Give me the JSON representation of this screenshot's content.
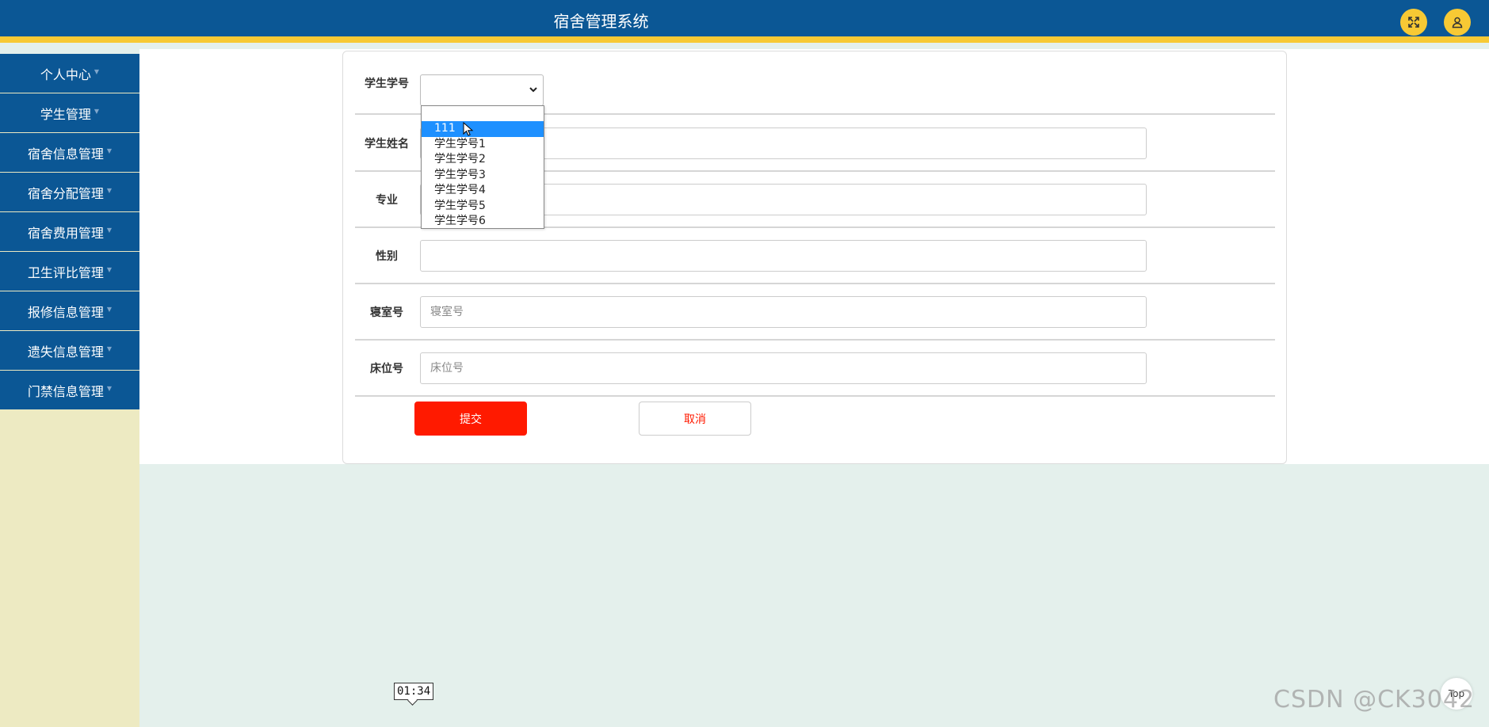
{
  "app": {
    "title": "宿舍管理系统"
  },
  "header_buttons": {
    "expand_icon": "expand-arrows-icon",
    "user_icon": "user-icon"
  },
  "sidebar": {
    "items": [
      {
        "label": "个人中心"
      },
      {
        "label": "学生管理"
      },
      {
        "label": "宿舍信息管理"
      },
      {
        "label": "宿舍分配管理"
      },
      {
        "label": "宿舍费用管理"
      },
      {
        "label": "卫生评比管理"
      },
      {
        "label": "报修信息管理"
      },
      {
        "label": "遗失信息管理"
      },
      {
        "label": "门禁信息管理"
      }
    ]
  },
  "form": {
    "student_id": {
      "label": "学生学号",
      "value": ""
    },
    "student_name": {
      "label": "学生姓名",
      "value": ""
    },
    "major": {
      "label": "专业",
      "value": ""
    },
    "gender": {
      "label": "性别",
      "value": ""
    },
    "room_no": {
      "label": "寝室号",
      "placeholder": "寝室号"
    },
    "bed_no": {
      "label": "床位号",
      "placeholder": "床位号"
    },
    "submit_label": "提交",
    "cancel_label": "取消"
  },
  "dropdown": {
    "options": [
      "",
      "111",
      "学生学号1",
      "学生学号2",
      "学生学号3",
      "学生学号4",
      "学生学号5",
      "学生学号6"
    ],
    "highlighted": "111"
  },
  "overlay": {
    "time_tooltip": "01:34",
    "top_button": "Top",
    "watermark": "CSDN @CK3042"
  },
  "colors": {
    "primary": "#0b5795",
    "accent": "#f7c934",
    "danger": "#ff1a00",
    "sidebar_bg": "#edeac2",
    "content_bg": "#e4f0ec",
    "highlight": "#1e90ff"
  }
}
